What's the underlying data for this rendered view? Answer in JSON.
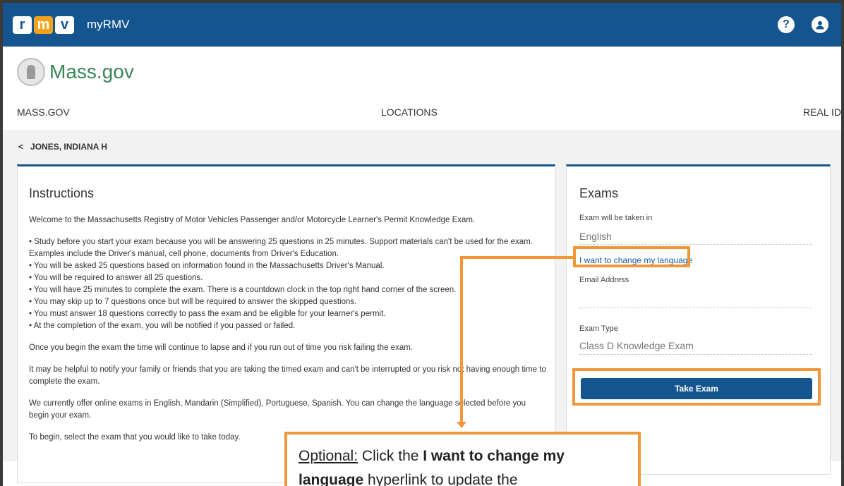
{
  "topbar": {
    "app_name": "myRMV",
    "logo_letters": [
      "r",
      "m",
      "v"
    ],
    "icons": [
      "help-icon",
      "user-icon"
    ]
  },
  "brand": {
    "name": "Mass.gov"
  },
  "nav": {
    "items": [
      "MASS.GOV",
      "LOCATIONS",
      "REAL ID"
    ]
  },
  "breadcrumb": {
    "back_glyph": "<",
    "label": "JONES, INDIANA H"
  },
  "instructions": {
    "title": "Instructions",
    "intro": "Welcome to the Massachusetts Registry of Motor Vehicles Passenger and/or Motorcycle Learner's Permit Knowledge Exam.",
    "bullets": [
      "• Study before you start your exam because you will be answering 25 questions in 25 minutes. Support materials can't be used for the exam. Examples include the Driver's manual, cell phone, documents from Driver's Education.",
      "• You will be asked 25 questions based on information found in the Massachusetts Driver's Manual.",
      "• You will be required to answer all 25 questions.",
      "• You will have 25 minutes to complete the exam. There is a countdown clock in the top right hand corner of the screen.",
      "• You may skip up to 7 questions once but will be required to answer the skipped questions.",
      "• You must answer 18 questions correctly to pass the exam and be eligible for your learner's permit.",
      "• At the completion of the exam, you will be notified if you passed or failed."
    ],
    "para_time": "Once you begin the exam the time will continue to lapse and if you run out of time you risk failing the exam.",
    "para_notify": "It may be helpful to notify your family or friends that you are taking the timed exam and can't be interrupted or you risk not having enough time to complete the exam.",
    "para_languages": "We currently offer online exams in English, Mandarin (Simplified), Portuguese, Spanish. You can change the language selected before you begin your exam.",
    "para_begin": "To begin, select the exam that you would like to take today."
  },
  "exams": {
    "title": "Exams",
    "language_label": "Exam will be taken in",
    "language_value": "English",
    "change_language_link": "I want to change my language",
    "email_label": "Email Address",
    "email_value": "",
    "type_label": "Exam Type",
    "type_value": "Class D Knowledge Exam",
    "take_exam_button": "Take Exam"
  },
  "callout": {
    "optional": "Optional:",
    "text_1": " Click the ",
    "bold_1": "I want to change my language",
    "text_2": " hyperlink to update the"
  },
  "colors": {
    "header_blue": "#14558f",
    "mass_green": "#388557",
    "annotation_orange": "#f0973b",
    "link_blue": "#1a5ca8"
  }
}
